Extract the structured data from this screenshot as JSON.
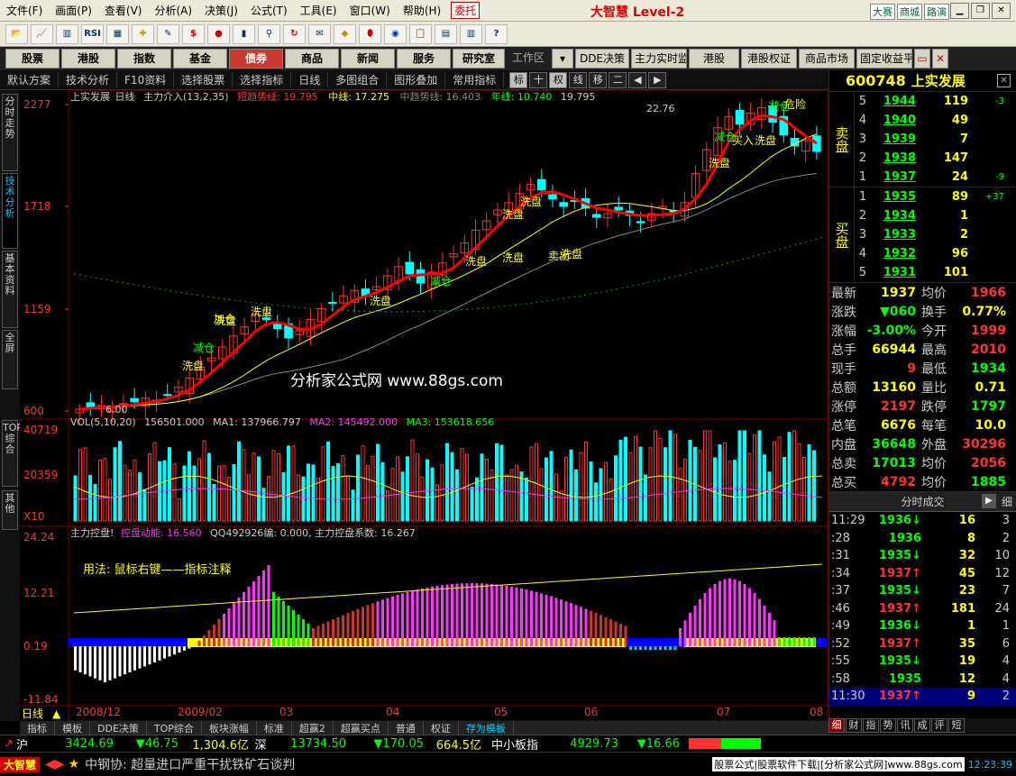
{
  "menu": [
    "文件(F)",
    "画面(P)",
    "查看(V)",
    "分析(A)",
    "决策(J)",
    "公式(T)",
    "工具(E)",
    "窗口(W)",
    "帮助(H)"
  ],
  "menu_tag": "委托",
  "brand": "大智慧 Level-2",
  "top_right": [
    "大赛",
    "商城",
    "路演"
  ],
  "toolbar_icons": [
    "open-icon",
    "chart-icon",
    "kline-icon",
    "rsi-icon",
    "grid-icon",
    "crosshair-icon",
    "pencil-icon",
    "dollar-icon",
    "signal-icon",
    "bars-icon",
    "binoculars-icon",
    "refresh-icon",
    "envelope-icon",
    "diamond-icon",
    "egg-icon",
    "globe-icon",
    "clipboard-icon",
    "calc-icon",
    "books-icon",
    "help-icon"
  ],
  "toolbar_labels": {
    "rsi": "RSI",
    "dollar": "$"
  },
  "nav": [
    "股票",
    "港股",
    "指数",
    "基金",
    "债券",
    "商品",
    "新闻",
    "服务",
    "研究室"
  ],
  "nav_active": "债券",
  "nav_plain": "工作区",
  "nav2": [
    "DDE决策",
    "主力实时监",
    "港股",
    "港股权证",
    "商品市场",
    "固定收益平"
  ],
  "subbar": [
    "默认方案",
    "技术分析",
    "F10资料",
    "选择股票",
    "选择指标",
    "日线",
    "多图组合",
    "图形叠加",
    "常用指标"
  ],
  "subbar_icons": [
    "标",
    "十",
    "权",
    "线",
    "移",
    "二"
  ],
  "vtabs": [
    "分时走势",
    "技术分析",
    "基本资料",
    "全屏",
    "TOP综合",
    "其他"
  ],
  "stock": {
    "code": "600748",
    "name": "上实发展"
  },
  "price_header": {
    "name": "上实发展",
    "period": "日线",
    "ind": "主力介入(13,2,35)",
    "l1": "短趋势线: 19.795",
    "l2": "中线: 17.275",
    "l3": "中趋势线: 16.403",
    "l4": "年线: 10.740",
    "l5": "19.795"
  },
  "price_axis": [
    "2277",
    "1718",
    "1159",
    "600"
  ],
  "chart_marks": {
    "high": "22.76",
    "low": "6.00"
  },
  "annotations": [
    "洗盘",
    "减仓",
    "洗盘",
    "加仓",
    "洗盘",
    "减仓",
    "洗盘",
    "洗盘",
    "洗盘",
    "洗盘",
    "卖出",
    "洗盘",
    "买入",
    "洗盘",
    "减仓",
    "减仓",
    "危险",
    "洗盘",
    "洗盘"
  ],
  "watermark": "分析家公式网 www.88gs.com",
  "vol_header": {
    "a": "VOL(5,10,20)",
    "b": "156501.000",
    "c": "MA1: 137966.797",
    "d": "MA2: 145492.000",
    "e": "MA3: 153618.656"
  },
  "vol_axis": [
    "40719",
    "20359",
    "X10"
  ],
  "ind_header": {
    "a": "主力控盘!",
    "b": "控盘动能: 16.560",
    "c": "QQ492926编: 0.000, 主力控盘系数: 16.267"
  },
  "ind_axis": [
    "24.24",
    "12.21",
    "0.19",
    "-11.84"
  ],
  "ind_note": "用法:  鼠标右键——指标注释",
  "date_axis": [
    "2008/12",
    "2009/02",
    "03",
    "04",
    "05",
    "06",
    "07",
    "08"
  ],
  "period_label": "日线",
  "sell_book": [
    {
      "lv": "5",
      "px": "1944",
      "vol": "119",
      "chg": "-3"
    },
    {
      "lv": "4",
      "px": "1940",
      "vol": "49",
      "chg": ""
    },
    {
      "lv": "3",
      "px": "1939",
      "vol": "7",
      "chg": ""
    },
    {
      "lv": "2",
      "px": "1938",
      "vol": "147",
      "chg": ""
    },
    {
      "lv": "1",
      "px": "1937",
      "vol": "24",
      "chg": "-9"
    }
  ],
  "buy_book": [
    {
      "lv": "1",
      "px": "1935",
      "vol": "89",
      "chg": "+37"
    },
    {
      "lv": "2",
      "px": "1934",
      "vol": "1",
      "chg": ""
    },
    {
      "lv": "3",
      "px": "1933",
      "vol": "2",
      "chg": ""
    },
    {
      "lv": "4",
      "px": "1932",
      "vol": "96",
      "chg": ""
    },
    {
      "lv": "5",
      "px": "1931",
      "vol": "101",
      "chg": ""
    }
  ],
  "book_labels": {
    "sell": "卖盘",
    "buy": "买盘"
  },
  "stats": [
    {
      "l1": "最新",
      "v1": "1937",
      "c1": "yl",
      "l2": "均价",
      "v2": "1966",
      "c2": "up"
    },
    {
      "l1": "涨跌",
      "v1": "▼060",
      "c1": "dn",
      "l2": "换手",
      "v2": "0.77%",
      "c2": "yl"
    },
    {
      "l1": "涨幅",
      "v1": "-3.00%",
      "c1": "dn",
      "l2": "今开",
      "v2": "1999",
      "c2": "up"
    },
    {
      "l1": "总手",
      "v1": "66944",
      "c1": "yl",
      "l2": "最高",
      "v2": "2010",
      "c2": "up"
    },
    {
      "l1": "现手",
      "v1": "9",
      "c1": "up",
      "l2": "最低",
      "v2": "1934",
      "c2": "dn"
    },
    {
      "l1": "总额",
      "v1": "13160",
      "c1": "yl",
      "l2": "量比",
      "v2": "0.71",
      "c2": "yl"
    },
    {
      "l1": "涨停",
      "v1": "2197",
      "c1": "up",
      "l2": "跌停",
      "v2": "1797",
      "c2": "dn"
    },
    {
      "l1": "总笔",
      "v1": "6676",
      "c1": "yl",
      "l2": "每笔",
      "v2": "10.0",
      "c2": "yl"
    },
    {
      "l1": "内盘",
      "v1": "36648",
      "c1": "dn",
      "l2": "外盘",
      "v2": "30296",
      "c2": "up"
    },
    {
      "l1": "总卖",
      "v1": "17013",
      "c1": "dn",
      "l2": "均价",
      "v2": "2056",
      "c2": "up"
    },
    {
      "l1": "总买",
      "v1": "4792",
      "c1": "up",
      "l2": "均价",
      "v2": "1885",
      "c2": "dn"
    }
  ],
  "tick_header": "分时成交",
  "tick_header_right": "细",
  "ticks": [
    {
      "t": "11:29",
      "p": "1936",
      "d": "dn",
      "v": "16",
      "n": "3"
    },
    {
      "t": ":28",
      "p": "1936",
      "d": "",
      "v": "8",
      "n": "2"
    },
    {
      "t": ":31",
      "p": "1935",
      "d": "dn",
      "v": "32",
      "n": "10"
    },
    {
      "t": ":34",
      "p": "1937",
      "d": "up",
      "v": "45",
      "n": "12"
    },
    {
      "t": ":37",
      "p": "1935",
      "d": "dn",
      "v": "23",
      "n": "7"
    },
    {
      "t": ":46",
      "p": "1937",
      "d": "up",
      "v": "181",
      "n": "24"
    },
    {
      "t": ":49",
      "p": "1936",
      "d": "dn",
      "v": "1",
      "n": "1"
    },
    {
      "t": ":52",
      "p": "1937",
      "d": "up",
      "v": "35",
      "n": "6"
    },
    {
      "t": ":55",
      "p": "1935",
      "d": "dn",
      "v": "19",
      "n": "4"
    },
    {
      "t": ":58",
      "p": "1935",
      "d": "",
      "v": "12",
      "n": "4"
    },
    {
      "t": "11:30",
      "p": "1937",
      "d": "up",
      "v": "9",
      "n": "2"
    }
  ],
  "right_tabs": [
    "细",
    "财",
    "指",
    "势",
    "讯",
    "成",
    "评",
    "短"
  ],
  "bottom_tabs": [
    "指标",
    "模板",
    "DDE决策",
    "TOP综合",
    "板块涨幅",
    "标准",
    "超赢2",
    "超赢买点",
    "普通",
    "权证",
    "存为模板"
  ],
  "bottom_tabs_active": "存为模板",
  "status": {
    "sh": "沪",
    "sh_idx": "3424.69",
    "sh_chg": "▼46.75",
    "sh_amt": "1,304.6亿",
    "sz": "深",
    "sz_idx": "13734.50",
    "sz_chg": "▼170.05",
    "sz_amt": "664.5亿",
    "sm": "中小板指",
    "sm_idx": "4929.73",
    "sm_chg": "▼16.66"
  },
  "ticker": {
    "logo": "大智慧",
    "text": "中钢协: 超量进口严重干扰铁矿石谈判",
    "promo": "股票公式|股票软件下载|[分析家公式网]www.88gs.com",
    "clock": "12:23:39"
  },
  "candles": {
    "closes": [
      6.1,
      6.2,
      6.3,
      6.2,
      6.4,
      6.5,
      6.7,
      6.6,
      6.9,
      7.3,
      7.8,
      8.4,
      8.9,
      9.5,
      10.1,
      10.6,
      11.3,
      11.0,
      10.5,
      10.0,
      10.4,
      11.0,
      11.6,
      11.9,
      12.3,
      12.6,
      12.3,
      12.8,
      13.4,
      13.9,
      13.5,
      13.0,
      13.6,
      14.1,
      14.6,
      15.2,
      15.9,
      16.4,
      17.0,
      17.4,
      17.9,
      18.4,
      18.1,
      17.6,
      17.2,
      17.5,
      17.1,
      16.6,
      16.8,
      17.0,
      16.7,
      16.3,
      16.8,
      17.2,
      16.9,
      17.4,
      19.0,
      20.3,
      21.5,
      22.1,
      21.7,
      22.3,
      22.6,
      21.8,
      21.1,
      20.5,
      20.8,
      20.2
    ]
  }
}
